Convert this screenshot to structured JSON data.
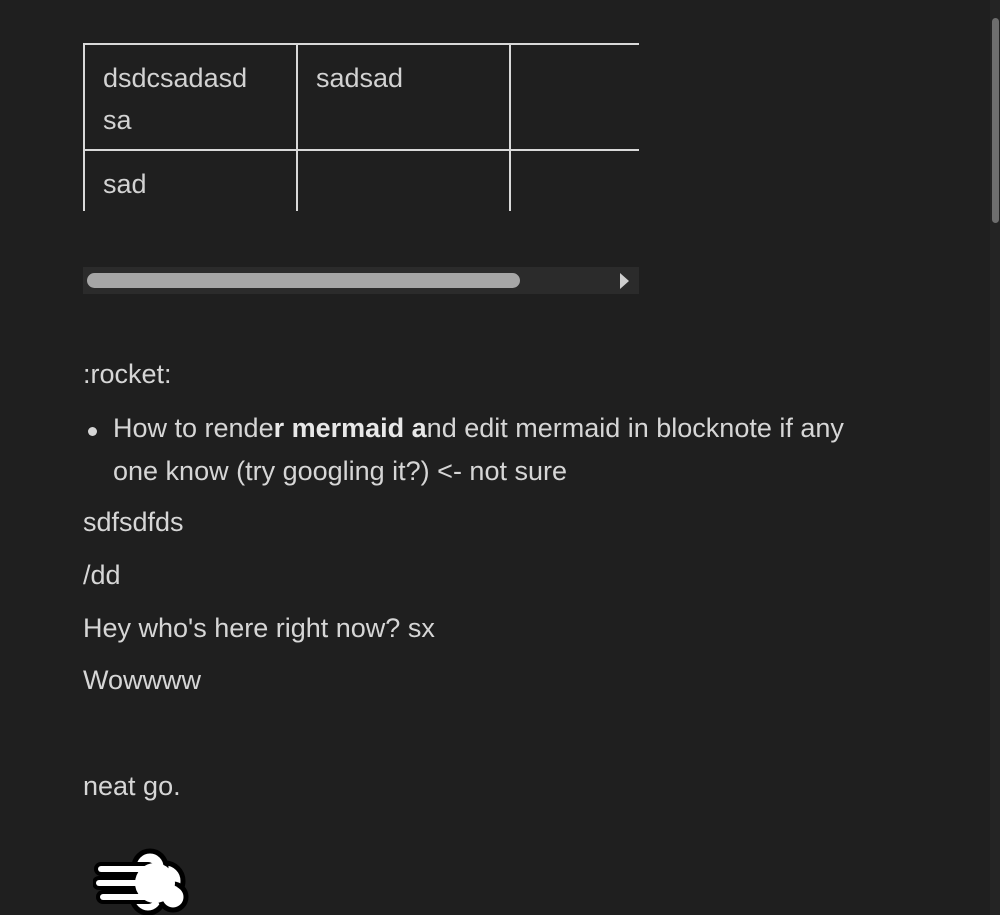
{
  "table": {
    "rows": [
      [
        "dsdcsadasd sa",
        "sadsad",
        ""
      ],
      [
        "sad",
        "",
        ""
      ]
    ]
  },
  "content": {
    "emoji_shortcode": ":rocket:",
    "bullet": {
      "part1": "How to rende",
      "bold": "r mermaid a",
      "part2": "nd edit mermaid in blocknote if any one know (try googling it?) <- not sure"
    },
    "lines": [
      "sdfsdfds",
      "/dd",
      "Hey who's here right now? sx",
      "Wowwww",
      "neat go."
    ]
  },
  "icons": {
    "bottom": "dash-cloud-icon"
  },
  "colors": {
    "background": "#1f1f1f",
    "text": "#d6d6d6",
    "border": "#d9d9d9"
  }
}
